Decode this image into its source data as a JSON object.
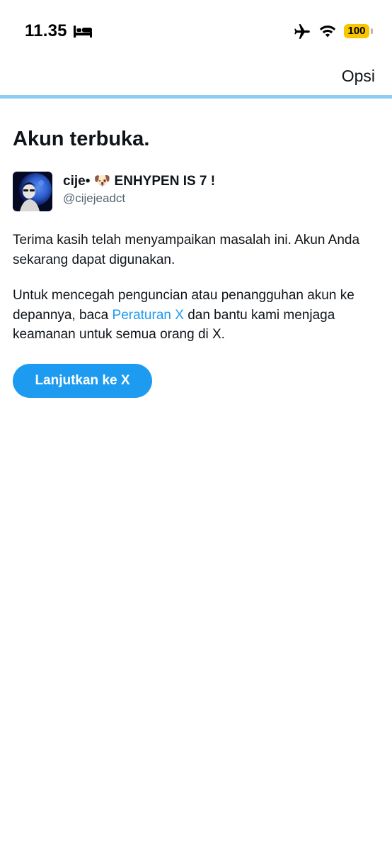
{
  "status_bar": {
    "time": "11.35",
    "focus_icon": "bed-icon",
    "airplane_icon": "airplane-icon",
    "wifi_icon": "wifi-icon",
    "battery_level": "100",
    "battery_color": "#f7c600"
  },
  "nav": {
    "options_label": "Opsi"
  },
  "progress": {
    "fraction": 1.0,
    "color": "#8ecdf3"
  },
  "heading": "Akun terbuka.",
  "user": {
    "name": "cije• 🐶 ENHYPEN IS 7 !",
    "handle": "@cijejeadct",
    "avatar_icon": "avatar-image"
  },
  "message": {
    "paragraph1": "Terima kasih telah menyampaikan masalah ini. Akun Anda sekarang dapat digunakan.",
    "paragraph2_before": "Untuk mencegah penguncian atau penangguhan akun ke depannya, baca ",
    "paragraph2_link": "Peraturan X",
    "paragraph2_after": " dan bantu kami menjaga keamanan untuk semua orang di X."
  },
  "cta": {
    "label": "Lanjutkan ke X",
    "color": "#1d9bf0"
  }
}
